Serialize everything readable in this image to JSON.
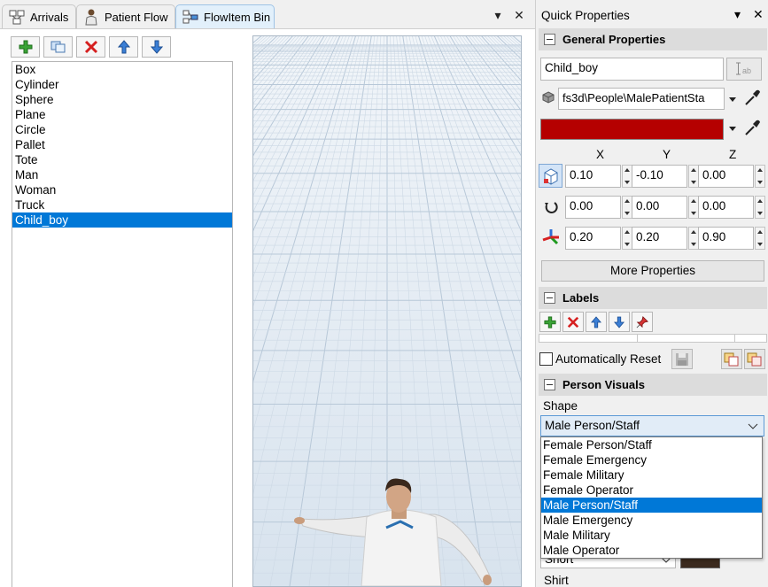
{
  "tabs": [
    {
      "label": "Arrivals",
      "icon": "arrivals-icon",
      "active": false
    },
    {
      "label": "Patient Flow",
      "icon": "patient-flow-icon",
      "active": false
    },
    {
      "label": "FlowItem Bin",
      "icon": "flowitem-bin-icon",
      "active": true
    }
  ],
  "tab_controls": {
    "menu": "▾",
    "close": "✕"
  },
  "toolbar": [
    "add-icon",
    "duplicate-icon",
    "delete-icon",
    "move-up-icon",
    "move-down-icon"
  ],
  "flowitems": {
    "items": [
      "Box",
      "Cylinder",
      "Sphere",
      "Plane",
      "Circle",
      "Pallet",
      "Tote",
      "Man",
      "Woman",
      "Truck",
      "Child_boy"
    ],
    "selected": "Child_boy"
  },
  "quick_properties": {
    "title": "Quick Properties",
    "general": {
      "header": "General Properties",
      "name": "Child_boy",
      "shape_path": "fs3d\\People\\MalePatientSta",
      "color": "#b50000",
      "axes": [
        "X",
        "Y",
        "Z"
      ],
      "position": [
        "0.10",
        "-0.10",
        "0.00"
      ],
      "rotation": [
        "0.00",
        "0.00",
        "0.00"
      ],
      "size": [
        "0.20",
        "0.20",
        "0.90"
      ],
      "more_button": "More Properties"
    },
    "labels": {
      "header": "Labels",
      "auto_reset_label": "Automatically Reset",
      "auto_reset_checked": false
    },
    "person_visuals": {
      "header": "Person Visuals",
      "shape_label": "Shape",
      "shape_value": "Male Person/Staff",
      "shape_options": [
        "Female Person/Staff",
        "Female Emergency",
        "Female Military",
        "Female Operator",
        "Male Person/Staff",
        "Male Emergency",
        "Male Military",
        "Male Operator"
      ],
      "hair_value": "Short",
      "shirt_label": "Shirt"
    }
  }
}
